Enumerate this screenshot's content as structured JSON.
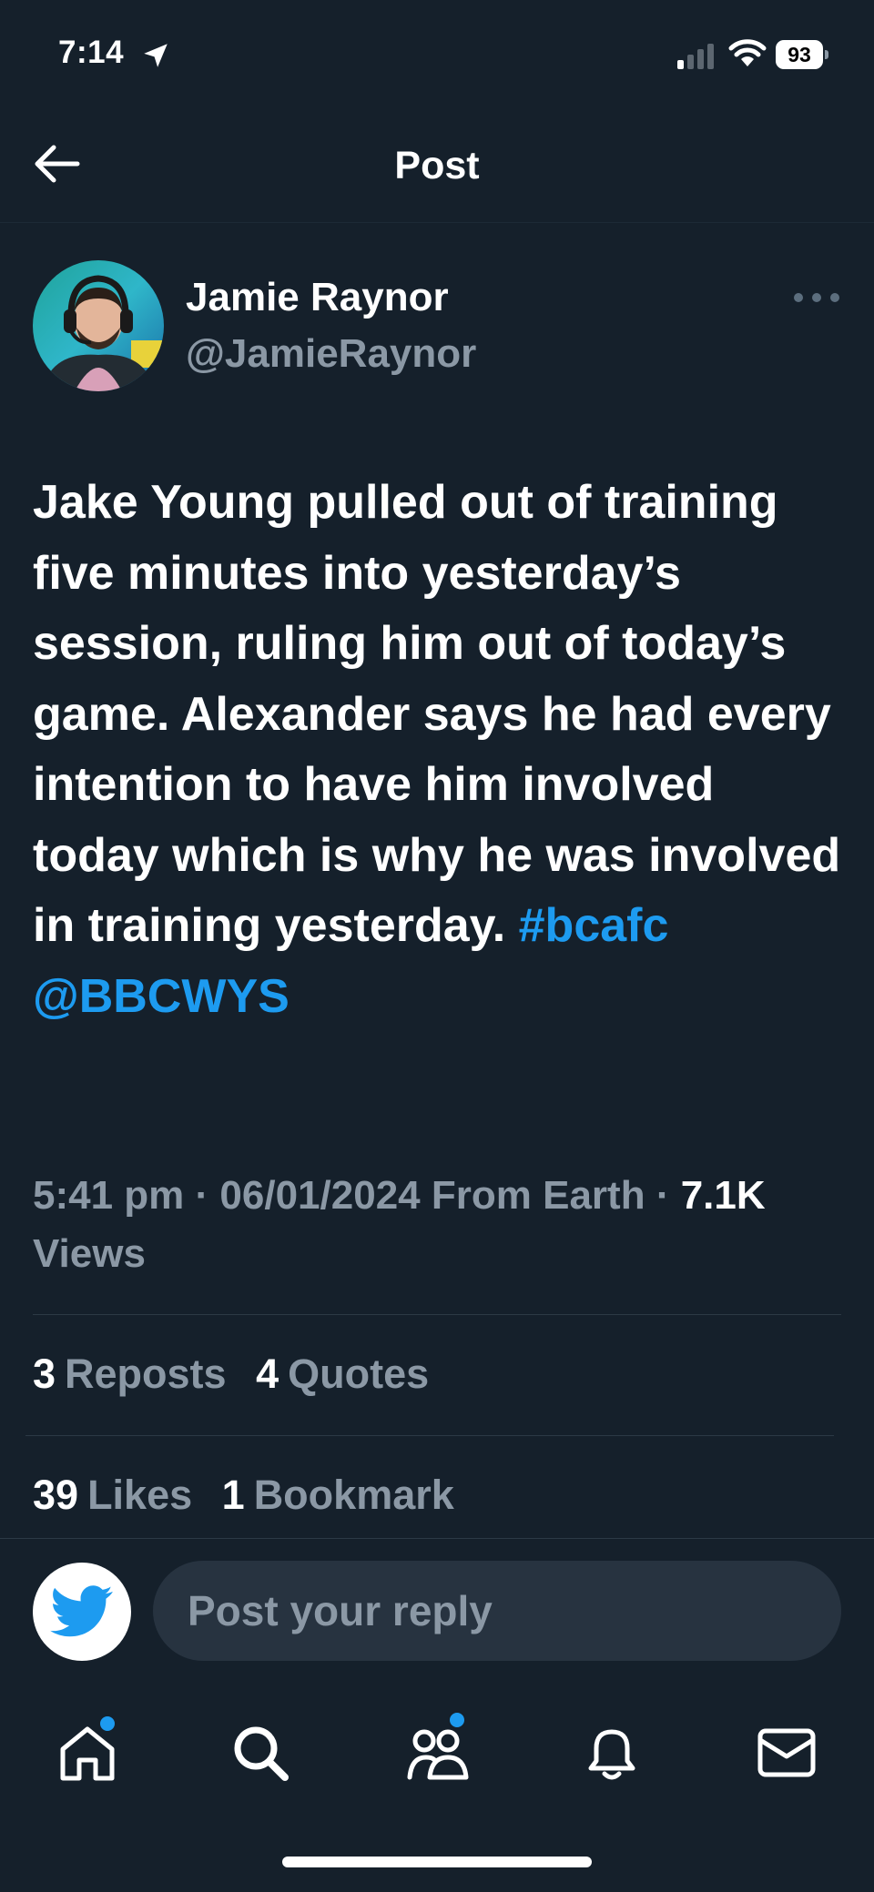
{
  "status_bar": {
    "time": "7:14",
    "battery": "93"
  },
  "header": {
    "title": "Post"
  },
  "author": {
    "name": "Jamie Raynor",
    "handle": "@JamieRaynor"
  },
  "post": {
    "text": "Jake Young pulled out of training five minutes into yesterday’s session, ruling him out of today’s game. Alexander says he had every intention to have him involved today which is why he was involved in training yesterday.",
    "hashtag": "#bcafc",
    "mention": "@BBCWYS"
  },
  "meta": {
    "time": "5:41 pm",
    "date": "06/01/2024",
    "source": "From Earth",
    "separator": "·",
    "views_count": "7.1K",
    "views_label": "Views"
  },
  "stats": {
    "reposts": {
      "count": "3",
      "label": "Reposts"
    },
    "quotes": {
      "count": "4",
      "label": "Quotes"
    },
    "likes": {
      "count": "39",
      "label": "Likes"
    },
    "bookmarks": {
      "count": "1",
      "label": "Bookmark"
    }
  },
  "reply": {
    "placeholder": "Post your reply"
  },
  "tabs": [
    "home-icon",
    "search-icon",
    "communities-icon",
    "notifications-icon",
    "messages-icon"
  ],
  "colors": {
    "background": "#15202b",
    "accent": "#1d9bf0",
    "muted": "#8b98a5",
    "input_bg": "#273340"
  }
}
